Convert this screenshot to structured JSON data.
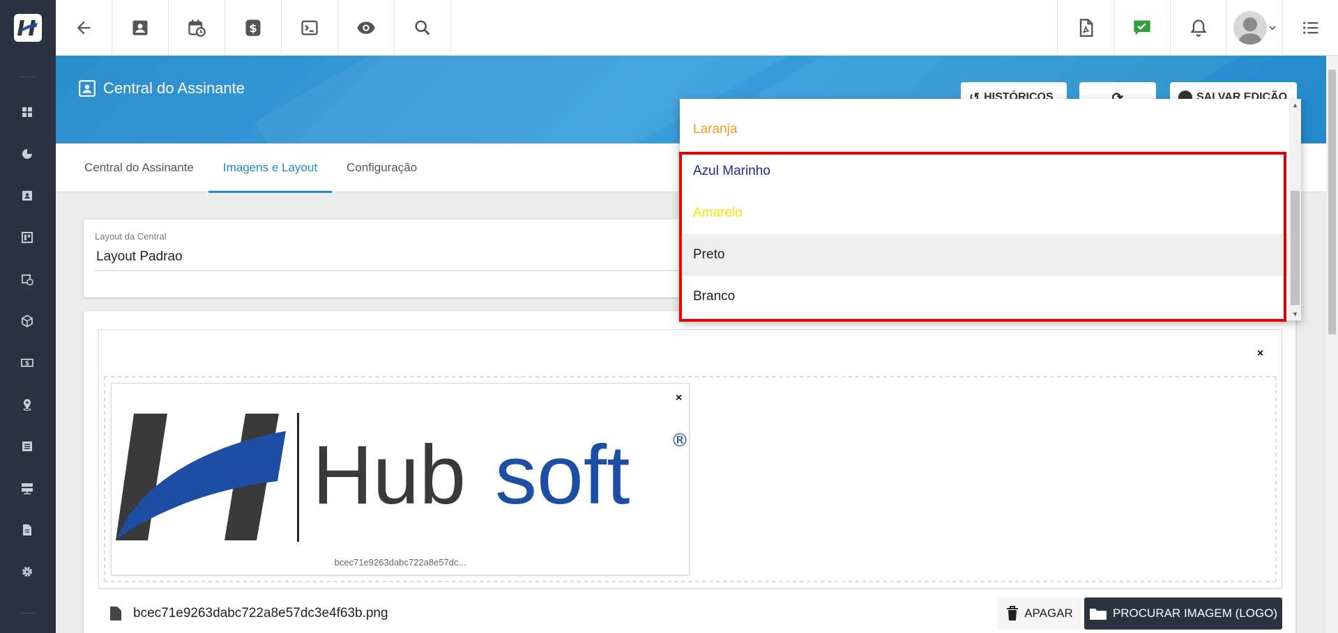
{
  "topbar": {
    "buttons": [
      "back-arrow-icon",
      "contact-card-icon",
      "calendar-clock-icon",
      "dollar-icon",
      "terminal-icon",
      "eye-icon",
      "search-icon"
    ],
    "right_buttons": [
      "pdf-icon",
      "chat-check-icon",
      "bell-icon",
      "avatar",
      "list-icon"
    ],
    "chat_color": "#2e9e3a"
  },
  "header": {
    "title": "Central do Assinante",
    "btn_historicos": "HISTÓRICOS",
    "btn_salvar": "SALVAR EDIÇÃO"
  },
  "tabs": [
    {
      "label": "Central do Assinante",
      "active": false
    },
    {
      "label": "Imagens e Layout",
      "active": true
    },
    {
      "label": "Configuração",
      "active": false
    }
  ],
  "layout_field": {
    "label": "Layout da Central",
    "value": "Layout Padrao"
  },
  "image": {
    "preview_filename": "bcec71e9263dabc722a8e57dc...",
    "logo_text_dark": "Hub",
    "logo_text_blue": "soft",
    "logo_registered": "®",
    "close_symbol": "×"
  },
  "file_row": {
    "filename": "bcec71e9263dabc722a8e57dc3e4f63b.png",
    "delete_label": "APAGAR",
    "browse_label": "PROCURAR IMAGEM (LOGO)"
  },
  "dropdown": {
    "options": [
      {
        "label": "Laranja",
        "color": "#f0a020"
      },
      {
        "label": "Azul Marinho",
        "color": "#1a2f8a"
      },
      {
        "label": "Amarelo",
        "color": "#f2e600"
      },
      {
        "label": "Preto",
        "color": "#222222"
      },
      {
        "label": "Branco",
        "color": "#222222"
      }
    ],
    "highlighted_index": 3
  },
  "colors": {
    "accent": "#2389c8",
    "sidebar": "#2b3341",
    "highlight_box": "#e30000"
  }
}
